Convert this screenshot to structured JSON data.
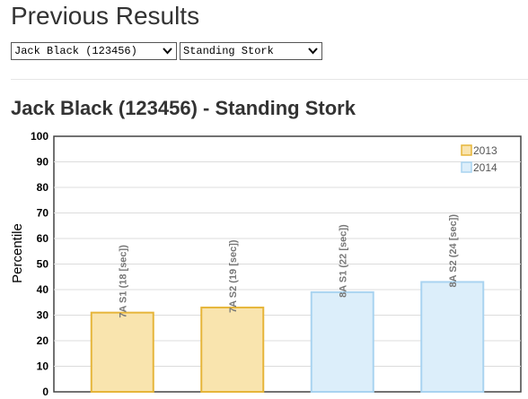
{
  "page": {
    "title": "Previous Results"
  },
  "filters": {
    "athlete_selected": "Jack Black (123456)",
    "test_selected": "Standing Stork"
  },
  "icons": {
    "dropdown": "chevron-down-icon"
  },
  "chart_data": {
    "type": "bar",
    "title": "Jack Black (123456) - Standing Stork",
    "xlabel": "",
    "ylabel": "Percentile",
    "ylim": [
      0,
      100
    ],
    "yticks": [
      0,
      10,
      20,
      30,
      40,
      50,
      60,
      70,
      80,
      90,
      100
    ],
    "grid": true,
    "legend_position": "top-right",
    "categories": [
      "7A S1 (18 [sec])",
      "7A S2 (19 [sec])",
      "8A S1 (22 [sec])",
      "8A S2 (24 [sec])"
    ],
    "values": [
      31,
      33,
      39,
      43
    ],
    "category_series": [
      "2013",
      "2013",
      "2014",
      "2014"
    ],
    "series": [
      {
        "name": "2013",
        "fill": "#f9e4ae",
        "stroke": "#e6b53a"
      },
      {
        "name": "2014",
        "fill": "#dceefa",
        "stroke": "#a9d3f0"
      }
    ]
  }
}
